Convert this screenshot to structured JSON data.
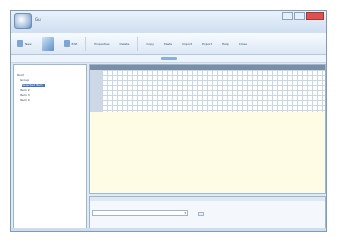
{
  "window": {
    "title": "Gu"
  },
  "toolbar": {
    "items": [
      {
        "label": "New",
        "icon": "document-icon"
      },
      {
        "label": "",
        "icon": "large-tool-icon"
      },
      {
        "label": "Edit",
        "icon": "edit-icon"
      },
      {
        "label": "Properties",
        "icon": "properties-icon"
      },
      {
        "label": "Delete",
        "icon": "delete-icon"
      },
      {
        "label": "Copy",
        "icon": "copy-icon"
      },
      {
        "label": "Paste",
        "icon": "paste-icon"
      },
      {
        "label": "Import",
        "icon": "import-icon"
      },
      {
        "label": "Export",
        "icon": "export-icon"
      },
      {
        "label": "Help",
        "icon": "help-icon"
      },
      {
        "label": "Close",
        "icon": "close-icon"
      }
    ]
  },
  "sidebar": {
    "items": [
      {
        "label": "Root"
      },
      {
        "label": "Group"
      },
      {
        "label": "Selected Item"
      },
      {
        "label": "Item 2"
      },
      {
        "label": "Item 3"
      },
      {
        "label": "Item 4"
      }
    ]
  },
  "grid": {
    "row_labels": [
      "",
      "",
      "",
      "",
      "",
      ""
    ],
    "values_right": [
      "",
      "",
      "",
      "",
      ""
    ]
  },
  "bottom_panel": {
    "label": "",
    "select_value": ""
  }
}
